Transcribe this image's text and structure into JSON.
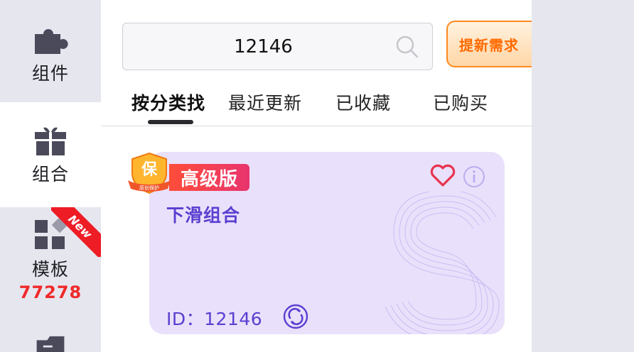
{
  "sidebar": {
    "items": [
      {
        "label": "组件",
        "icon": "puzzle-icon"
      },
      {
        "label": "组合",
        "icon": "gift-icon",
        "active": true
      },
      {
        "label": "模板",
        "icon": "template-grid-icon",
        "count": "77278",
        "ribbon": "New"
      },
      {
        "label": "",
        "icon": "folder-icon"
      }
    ]
  },
  "search": {
    "value": "12146",
    "placeholder": ""
  },
  "request_button": {
    "label": "提新需求"
  },
  "tabs": [
    {
      "label": "按分类找",
      "active": true
    },
    {
      "label": "最近更新"
    },
    {
      "label": "已收藏"
    },
    {
      "label": "已购买"
    }
  ],
  "card": {
    "badge": "高级版",
    "shield_text": "保",
    "shield_sub": "原创保护",
    "title": "下滑组合",
    "id_text": "ID：12146"
  },
  "colors": {
    "accent_purple": "#5b3fd0",
    "card_bg": "#e9e0fb",
    "badge_red": "#ee1c25",
    "request_orange": "#ff6a00"
  }
}
